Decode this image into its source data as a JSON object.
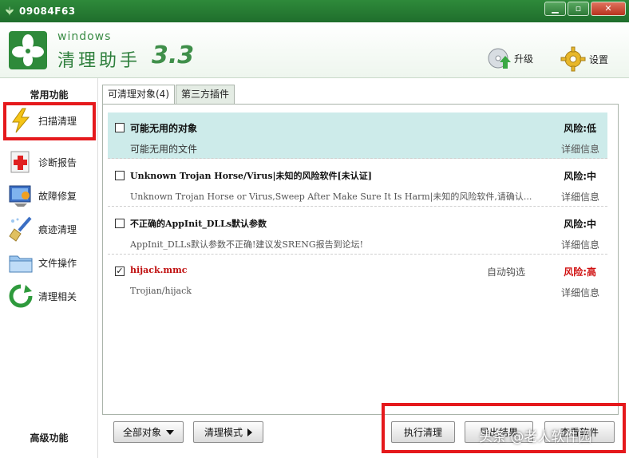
{
  "window": {
    "title": "09084F63",
    "icon": "clover-leaf-icon",
    "controls": [
      "minimize-icon",
      "restore-icon",
      "close-icon"
    ]
  },
  "header": {
    "brand_small": "windows",
    "brand_name": "清理助手",
    "brand_version": "3.3",
    "upgrade_label": "升级",
    "settings_label": "设置",
    "accent_color": "#2e7f3c"
  },
  "sidebar": {
    "common_heading": "常用功能",
    "advanced_heading": "高级功能",
    "items": [
      {
        "label": "扫描清理",
        "icon": "lightning-icon",
        "selected": true
      },
      {
        "label": "诊断报告",
        "icon": "medical-cross-icon"
      },
      {
        "label": "故障修复",
        "icon": "repair-tools-icon"
      },
      {
        "label": "痕迹清理",
        "icon": "broom-icon"
      },
      {
        "label": "文件操作",
        "icon": "folder-icon"
      },
      {
        "label": "清理相关",
        "icon": "refresh-arrow-icon"
      }
    ]
  },
  "tabs": [
    {
      "label": "可清理对象(4)",
      "active": true
    },
    {
      "label": "第三方插件",
      "active": false
    }
  ],
  "items": [
    {
      "name": "可能无用的对象",
      "desc": "可能无用的文件",
      "risk": "风险:低",
      "details": "详细信息",
      "checked": false
    },
    {
      "name": "Unknown Trojan Horse/Virus|未知的风险软件[未认证]",
      "desc": "Unknown Trojan Horse or Virus,Sweep After Make Sure It Is Harm|未知的风险软件,请确认...",
      "risk": "风险:中",
      "details": "详细信息",
      "checked": false
    },
    {
      "name": "不正确的AppInit_DLLs默认参数",
      "desc": "AppInit_DLLs默认参数不正确!建议发SRENG报告到论坛!",
      "risk": "风险:中",
      "details": "详细信息",
      "checked": false
    },
    {
      "name": "hijack.mmc",
      "desc": "Trojian/hijack",
      "auto": "自动钩选",
      "risk": "风险:高",
      "details": "详细信息",
      "checked": true
    }
  ],
  "buttons": {
    "all_objects": "全部对象",
    "clean_mode": "清理模式",
    "execute": "执行清理",
    "export": "导出结果",
    "view_software": "查看软件"
  },
  "watermark": "头条 @老人软件园",
  "colors": {
    "title_bar": "#1f6e2c",
    "selected_row": "#cdebea",
    "risk_high": "#d01010",
    "highlight_frame": "#e5191c"
  }
}
